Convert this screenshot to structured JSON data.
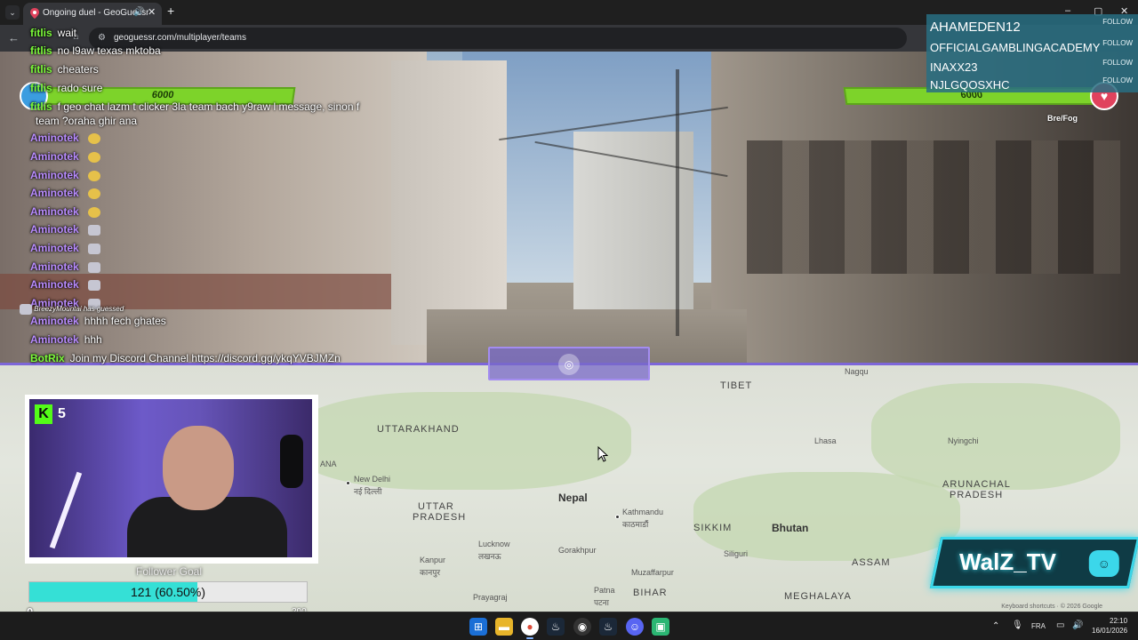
{
  "browser": {
    "tab_title": "Ongoing duel - GeoGuessr",
    "url": "geoguessr.com/multiplayer/teams",
    "tab_audio_icon": "speaker-icon",
    "tab_close_icon": "close-icon",
    "new_tab_icon": "plus-icon"
  },
  "game": {
    "left_team_health": "6000",
    "right_team_health": "6000",
    "right_team_name": "Bre/Fog"
  },
  "chat": {
    "messages": [
      {
        "user": "fitlis",
        "text": "wait",
        "color": "#7cfc3a"
      },
      {
        "user": "fitlis",
        "text": "no l9aw texas mktoba",
        "color": "#7cfc3a"
      },
      {
        "user": "fitlis",
        "text": "cheaters",
        "color": "#7cfc3a"
      },
      {
        "user": "fitlis",
        "text": "rado sure",
        "color": "#7cfc3a"
      },
      {
        "user": "fitlis",
        "text": "f geo chat lazm t clicker 3la team bach y9raw l message, sinon f",
        "color": "#7cfc3a"
      },
      {
        "user": "",
        "text": "team ?oraha ghir ana",
        "color": "#7cfc3a"
      },
      {
        "user": "Aminotek",
        "text": "",
        "color": "#b98cff",
        "emote": "yellow"
      },
      {
        "user": "Aminotek",
        "text": "",
        "color": "#b98cff",
        "emote": "yellow"
      },
      {
        "user": "Aminotek",
        "text": "",
        "color": "#b98cff",
        "emote": "yellow"
      },
      {
        "user": "Aminotek",
        "text": "",
        "color": "#b98cff",
        "emote": "yellow"
      },
      {
        "user": "Aminotek",
        "text": "",
        "color": "#b98cff",
        "emote": "yellow"
      },
      {
        "user": "Aminotek",
        "text": "",
        "color": "#b98cff",
        "emote": "grey"
      },
      {
        "user": "Aminotek",
        "text": "",
        "color": "#b98cff",
        "emote": "grey"
      },
      {
        "user": "Aminotek",
        "text": "",
        "color": "#b98cff",
        "emote": "grey"
      },
      {
        "user": "Aminotek",
        "text": "",
        "color": "#b98cff",
        "emote": "grey"
      },
      {
        "user": "Aminotek",
        "text": "",
        "color": "#b98cff",
        "emote": "grey"
      },
      {
        "user": "Aminotek",
        "text": "hhhh fech ghates",
        "color": "#b98cff"
      },
      {
        "user": "Aminotek",
        "text": "hhh",
        "color": "#b98cff"
      },
      {
        "user": "BotRix",
        "text": "Join my Discord Channel https://discord.gg/ykqYVBJMZn",
        "color": "#7cfc3a"
      }
    ],
    "guess_notice_user": "BreezyMountai",
    "guess_notice_text": "has guessed"
  },
  "follows": {
    "items": [
      {
        "name": "AHAMEDEN12",
        "button": "FOLLOW"
      },
      {
        "name": "OFFICIALGAMBLINGACADEMY",
        "button": "FOLLOW"
      },
      {
        "name": "INAXX23",
        "button": "FOLLOW"
      },
      {
        "name": "NJLGQOSXHC",
        "button": "FOLLOW"
      }
    ]
  },
  "map": {
    "labels": {
      "tibet": "TIBET",
      "nagqu": "Nagqu",
      "uttarakhand": "UTTARAKHAND",
      "new_delhi": "New Delhi",
      "new_delhi_hi": "नई दिल्ली",
      "nepal": "Nepal",
      "kathmandu": "Kathmandu",
      "kathmandu_ne": "काठमाडौं",
      "uttar_pradesh_1": "UTTAR",
      "uttar_pradesh_2": "PRADESH",
      "lucknow": "Lucknow",
      "lucknow_hi": "लखनऊ",
      "kanpur": "Kanpur",
      "kanpur_hi": "कानपुर",
      "gorakhpur": "Gorakhpur",
      "patna": "Patna",
      "patna_hi": "पटना",
      "bihar": "BIHAR",
      "sikkim": "SIKKIM",
      "bhutan": "Bhutan",
      "lhasa": "Lhasa",
      "nyingchi": "Nyingchi",
      "arunachal_1": "ARUNACHAL",
      "arunachal_2": "PRADESH",
      "assam": "ASSAM",
      "meghalaya": "MEGHALAYA",
      "muzaffarpur": "Muzaffarpur",
      "siliguri": "Siliguri",
      "prayagraj": "Prayagraj",
      "ana": "ANA"
    },
    "attribution": "Keyboard shortcuts · © 2026 Google"
  },
  "stream": {
    "kick_count": "5",
    "follower_goal_title": "Follower Goal",
    "follower_goal_text": "121 (60.50%)",
    "follower_goal_fraction": 0.605,
    "follower_goal_min": "0",
    "follower_goal_max": "200",
    "brand": "WalZ_TV"
  },
  "taskbar": {
    "language": "FRA",
    "time": "22:10",
    "date": "16/01/2026"
  },
  "colors": {
    "accent_purple": "#7d66d9",
    "health_green": "#7dd32a",
    "goal_cyan": "#35e0d6",
    "brand_cyan": "#3bd7ea"
  }
}
